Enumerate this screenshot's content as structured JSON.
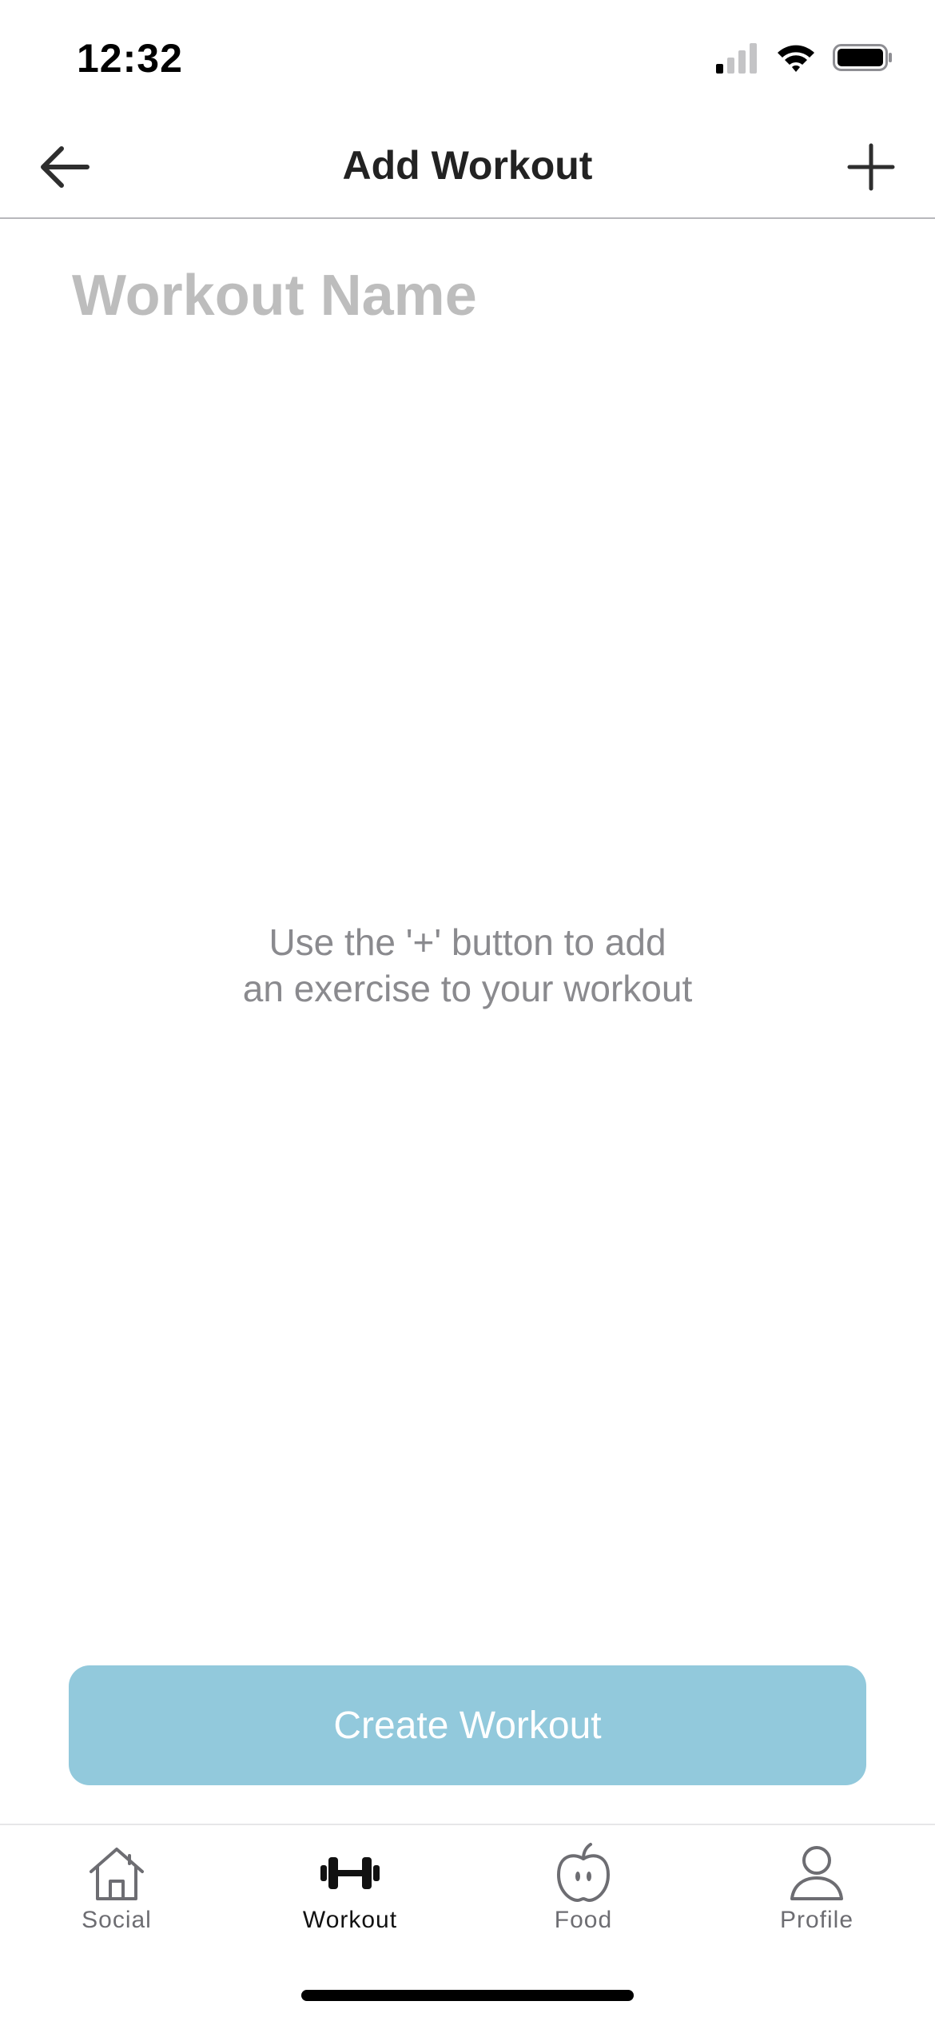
{
  "status_bar": {
    "time": "12:32"
  },
  "nav": {
    "title": "Add Workout",
    "back_icon": "arrow-left-icon",
    "add_icon": "plus-icon"
  },
  "form": {
    "workout_name_placeholder": "Workout Name",
    "workout_name_value": ""
  },
  "empty_state": {
    "line1": "Use the '+' button to add",
    "line2": "an exercise to your workout"
  },
  "actions": {
    "create_label": "Create Workout",
    "create_color": "#92c9dc"
  },
  "tabs": [
    {
      "label": "Social",
      "icon": "house-icon",
      "active": false
    },
    {
      "label": "Workout",
      "icon": "dumbbell-icon",
      "active": true
    },
    {
      "label": "Food",
      "icon": "apple-icon",
      "active": false
    },
    {
      "label": "Profile",
      "icon": "person-icon",
      "active": false
    }
  ]
}
